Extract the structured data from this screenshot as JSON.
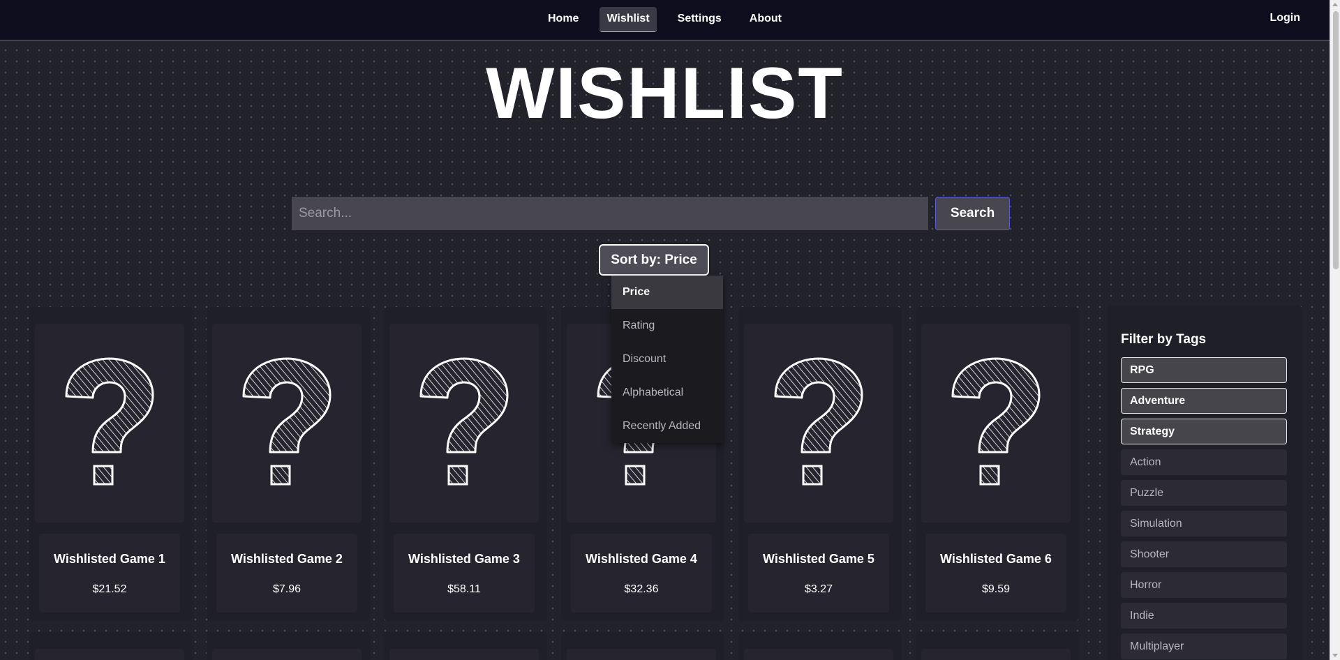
{
  "nav": {
    "links": [
      {
        "label": "Home",
        "active": false
      },
      {
        "label": "Wishlist",
        "active": true
      },
      {
        "label": "Settings",
        "active": false
      },
      {
        "label": "About",
        "active": false
      }
    ],
    "login_label": "Login"
  },
  "page": {
    "title": "WISHLIST"
  },
  "search": {
    "placeholder": "Search...",
    "value": "",
    "button_label": "Search"
  },
  "sort": {
    "button_label": "Sort by: Price",
    "options": [
      "Price",
      "Rating",
      "Discount",
      "Alphabetical",
      "Recently Added"
    ],
    "selected": "Price"
  },
  "games": [
    {
      "title": "Wishlisted Game 1",
      "price": "$21.52",
      "icon": "question-mark-icon"
    },
    {
      "title": "Wishlisted Game 2",
      "price": "$7.96",
      "icon": "question-mark-icon"
    },
    {
      "title": "Wishlisted Game 3",
      "price": "$58.11",
      "icon": "question-mark-icon"
    },
    {
      "title": "Wishlisted Game 4",
      "price": "$32.36",
      "icon": "question-mark-icon"
    },
    {
      "title": "Wishlisted Game 5",
      "price": "$3.27",
      "icon": "question-mark-icon"
    },
    {
      "title": "Wishlisted Game 6",
      "price": "$9.59",
      "icon": "question-mark-icon"
    }
  ],
  "filter": {
    "title": "Filter by Tags",
    "tags": [
      {
        "label": "RPG",
        "active": true
      },
      {
        "label": "Adventure",
        "active": true
      },
      {
        "label": "Strategy",
        "active": true
      },
      {
        "label": "Action",
        "active": false
      },
      {
        "label": "Puzzle",
        "active": false
      },
      {
        "label": "Simulation",
        "active": false
      },
      {
        "label": "Shooter",
        "active": false
      },
      {
        "label": "Horror",
        "active": false
      },
      {
        "label": "Indie",
        "active": false
      },
      {
        "label": "Multiplayer",
        "active": false
      }
    ]
  },
  "colors": {
    "nav_bg": "#0e0d1e",
    "page_bg": "#22222b",
    "card_bg": "#1f1f27",
    "search_button_border": "#5b5bd6"
  }
}
